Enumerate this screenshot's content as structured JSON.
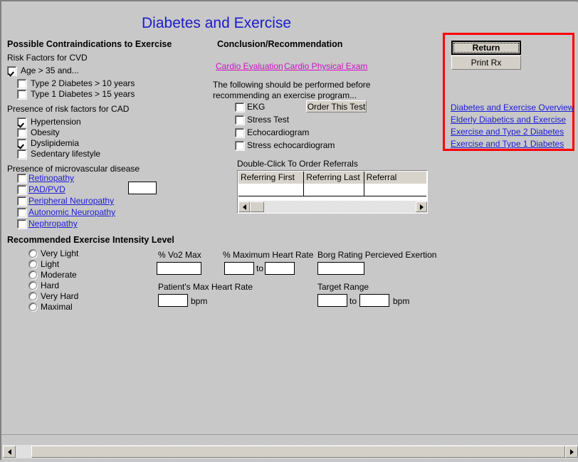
{
  "page": {
    "title": "Diabetes and Exercise",
    "title_color": "#1a1ad0",
    "bg_color": "#c8c8c8"
  },
  "left_column": {
    "heading": "Possible Contraindications to Exercise",
    "cvd_group_label": "Risk Factors for CVD",
    "cvd_items": [
      {
        "label": "Age > 35 and...",
        "checked": true,
        "indent": 0
      },
      {
        "label": "Type 2 Diabetes > 10 years",
        "checked": false,
        "indent": 1
      },
      {
        "label": "Type 1 Diabetes > 15 years",
        "checked": false,
        "indent": 1
      }
    ],
    "cad_group_label": "Presence of risk factors for CAD",
    "cad_items": [
      {
        "label": "Hypertension",
        "checked": true
      },
      {
        "label": "Obesity",
        "checked": false
      },
      {
        "label": "Dyslipidemia",
        "checked": true
      },
      {
        "label": "Sedentary lifestyle",
        "checked": false
      }
    ],
    "micro_group_label": "Presence of microvascular disease",
    "micro_items": [
      {
        "label": "Retinopathy",
        "checked": false
      },
      {
        "label": "PAD/PVD",
        "checked": false
      },
      {
        "label": "Peripheral Neuropathy",
        "checked": false
      },
      {
        "label": "Autonomic Neuropathy",
        "checked": false
      },
      {
        "label": "Nephropathy",
        "checked": false
      }
    ],
    "micro_textbox_value": ""
  },
  "middle_column": {
    "heading": "Conclusion/Recommendation",
    "links": [
      {
        "label": "Cardio Evaluation",
        "color": "#d010c8"
      },
      {
        "label": "Cardio Physical Exam",
        "color": "#d010c8"
      }
    ],
    "instruction_line1": "The following should be performed before",
    "instruction_line2": "recommending an exercise program...",
    "test_items": [
      {
        "label": "EKG",
        "checked": false
      },
      {
        "label": "Stress Test",
        "checked": false
      },
      {
        "label": "Echocardiogram",
        "checked": false
      },
      {
        "label": "Stress echocardiogram",
        "checked": false
      }
    ],
    "order_test_button": "Order This Test",
    "referrals_label": "Double-Click To Order Referrals",
    "referrals_table": {
      "columns": [
        "Referring First",
        "Referring Last",
        "Referral"
      ],
      "rows": [
        [
          "",
          "",
          ""
        ]
      ]
    }
  },
  "right_panel": {
    "border_color": "#ff0000",
    "return_button": "Return",
    "print_button": "Print Rx",
    "links": [
      "Diabetes and Exercise Overview",
      "Elderly Diabetics and Exercise",
      "Exercise and Type 2 Diabetes",
      "Exercise and Type 1 Diabetes"
    ]
  },
  "intensity_section": {
    "heading": "Recommended Exercise Intensity Level",
    "levels": [
      {
        "label": "Very Light",
        "selected": false
      },
      {
        "label": "Light",
        "selected": false
      },
      {
        "label": "Moderate",
        "selected": false
      },
      {
        "label": "Hard",
        "selected": false
      },
      {
        "label": "Very Hard",
        "selected": false
      },
      {
        "label": "Maximal",
        "selected": false
      }
    ],
    "vo2_label": "% Vo2 Max",
    "vo2_value": "",
    "maxhr_label": "% Maximum Heart Rate",
    "maxhr_from": "",
    "maxhr_to_word": "to",
    "maxhr_to": "",
    "borg_label": "Borg Rating Percieved Exertion",
    "borg_value": "",
    "patient_maxhr_label": "Patient's Max Heart Rate",
    "patient_maxhr_value": "",
    "patient_maxhr_unit": "bpm",
    "target_label": "Target Range",
    "target_from": "",
    "target_to_word": "to",
    "target_to": "",
    "target_unit": "bpm"
  }
}
